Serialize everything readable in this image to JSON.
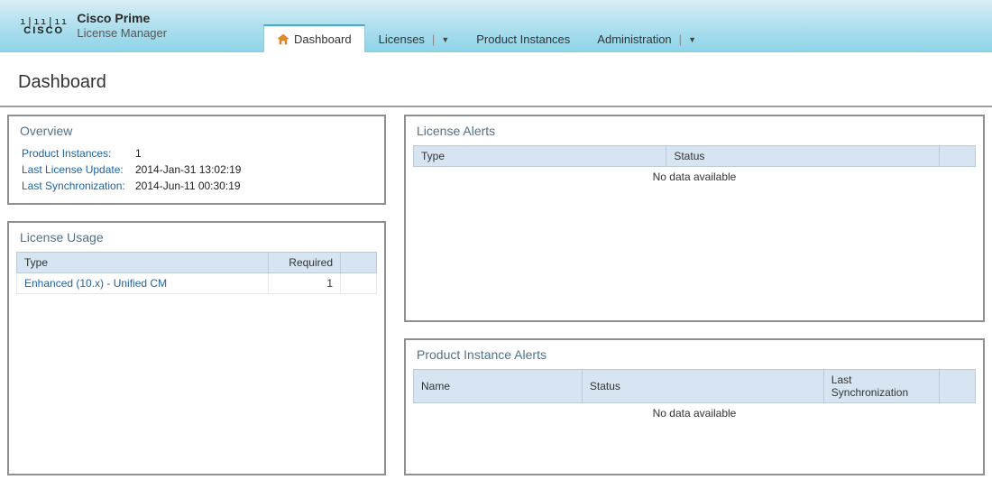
{
  "brand": {
    "main": "Cisco Prime",
    "sub": "License Manager"
  },
  "nav": {
    "dashboard": "Dashboard",
    "licenses": "Licenses",
    "product_instances": "Product Instances",
    "administration": "Administration"
  },
  "page": {
    "title": "Dashboard"
  },
  "overview": {
    "title": "Overview",
    "product_instances_label": "Product Instances:",
    "product_instances_value": "1",
    "last_license_update_label": "Last License Update:",
    "last_license_update_value": "2014-Jan-31 13:02:19",
    "last_sync_label": "Last Synchronization:",
    "last_sync_value": "2014-Jun-11 00:30:19"
  },
  "usage": {
    "title": "License Usage",
    "col_type": "Type",
    "col_required": "Required",
    "rows": [
      {
        "type": "Enhanced (10.x) - Unified CM",
        "required": "1"
      }
    ]
  },
  "license_alerts": {
    "title": "License Alerts",
    "col_type": "Type",
    "col_status": "Status",
    "nodata": "No data available"
  },
  "pi_alerts": {
    "title": "Product Instance Alerts",
    "col_name": "Name",
    "col_status": "Status",
    "col_last_sync": "Last Synchronization",
    "nodata": "No data available"
  }
}
